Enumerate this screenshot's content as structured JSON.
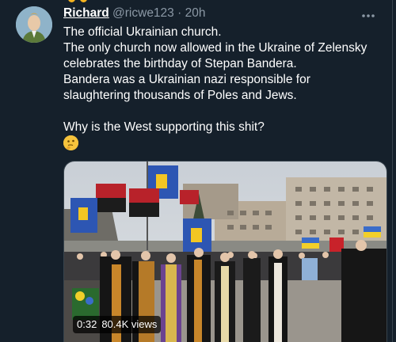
{
  "tweet": {
    "author_name": "Richard",
    "handle": "@ricwe123",
    "separator": "·",
    "time": "20h",
    "text": {
      "line1": "The official Ukrainian church.",
      "line2": "The only church now allowed in the Ukraine of Zelensky celebrates the birthday of Stepan Bandera.",
      "line3": "Bandera was a Ukrainian nazi responsible for slaughtering thousands of Poles and Jews.",
      "line4": "Why is the West supporting this shit?"
    },
    "emoji": "thinking-face-emoji"
  },
  "video": {
    "duration": "0:32",
    "views": "80.4K views"
  },
  "icons": {
    "more": "more-horizontal-icon",
    "avatar": "avatar"
  },
  "colors": {
    "background": "#15202b",
    "secondary_text": "#8b98a5",
    "border": "#38444d"
  }
}
